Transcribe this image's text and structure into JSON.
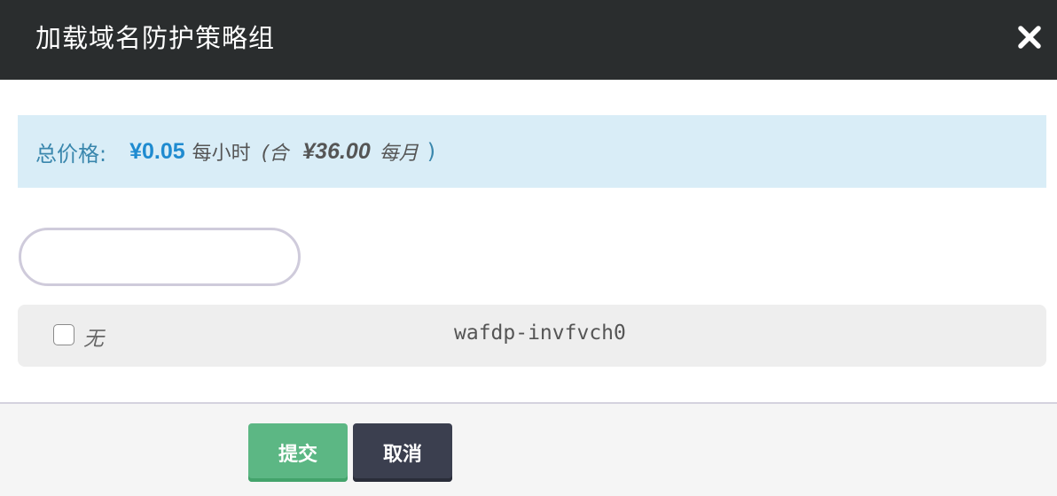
{
  "dialog": {
    "title": "加载域名防护策略组",
    "close_icon": "close-icon"
  },
  "price": {
    "label": "总价格:",
    "hourly_price": "¥0.05",
    "hourly_unit": "每小时",
    "paren_open": "(合",
    "monthly_price": "¥36.00",
    "monthly_unit": "每月",
    "paren_close": ")"
  },
  "search": {
    "value": "",
    "placeholder": ""
  },
  "policy_list": [
    {
      "checked": false,
      "option_label": "无",
      "name": "wafdp-invfvch0"
    }
  ],
  "footer": {
    "submit_label": "提交",
    "cancel_label": "取消"
  },
  "colors": {
    "header_bg": "#2a2d2e",
    "price_bar_bg": "#d9edf7",
    "price_accent": "#1f8bd0",
    "submit_bg": "#5cb784",
    "cancel_bg": "#3b3f4f"
  }
}
